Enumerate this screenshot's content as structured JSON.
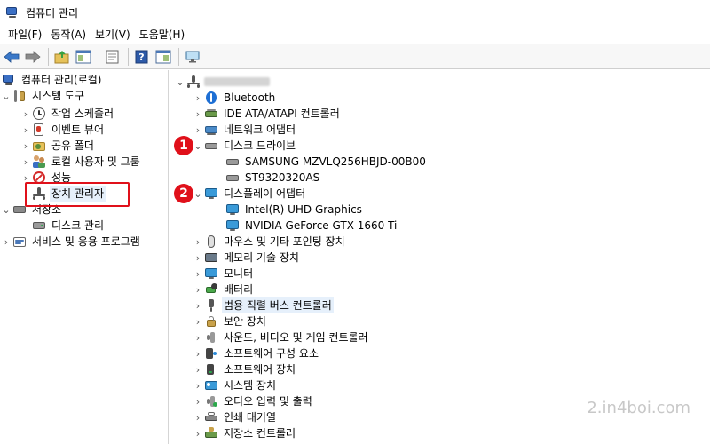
{
  "window": {
    "title": "컴퓨터 관리"
  },
  "menu": [
    "파일(F)",
    "동작(A)",
    "보기(V)",
    "도움말(H)"
  ],
  "toolbar_icons": [
    "back-arrow-icon",
    "forward-arrow-icon",
    "up-folder-icon",
    "show-hide-tree-icon",
    "properties-icon",
    "help-icon",
    "console-icon",
    "monitor-icon"
  ],
  "tree": {
    "root": "컴퓨터 관리(로컬)",
    "system_tools": "시스템 도구",
    "task_scheduler": "작업 스케줄러",
    "event_viewer": "이벤트 뷰어",
    "shared_folders": "공유 폴더",
    "local_users": "로컬 사용자 및 그룹",
    "performance": "성능",
    "device_manager": "장치 관리자",
    "storage": "저장소",
    "disk_management": "디스크 관리",
    "services": "서비스 및 응용 프로그램"
  },
  "devices": {
    "bluetooth": "Bluetooth",
    "ide": "IDE ATA/ATAPI 컨트롤러",
    "network": "네트워크 어댑터",
    "disk_drives": "디스크 드라이브",
    "disk1": "SAMSUNG MZVLQ256HBJD-00B00",
    "disk2": "ST9320320AS",
    "display": "디스플레이 어댑터",
    "gpu1": "Intel(R) UHD Graphics",
    "gpu2": "NVIDIA GeForce GTX 1660 Ti",
    "mouse": "마우스 및 기타 포인팅 장치",
    "memory": "메모리 기술 장치",
    "monitor": "모니터",
    "battery": "배터리",
    "usb": "범용 직렬 버스 컨트롤러",
    "security": "보안 장치",
    "sound": "사운드, 비디오 및 게임 컨트롤러",
    "sw_components": "소프트웨어 구성 요소",
    "sw_devices": "소프트웨어 장치",
    "system": "시스템 장치",
    "audio_io": "오디오 입력 및 출력",
    "print_queue": "인쇄 대기열",
    "storage_ctrl": "저장소 컨트롤러"
  },
  "badges": {
    "one": "1",
    "two": "2"
  },
  "watermark": "2.in4boi.com",
  "colors": {
    "highlight": "#e0101a",
    "selection": "#e6f0fb"
  }
}
